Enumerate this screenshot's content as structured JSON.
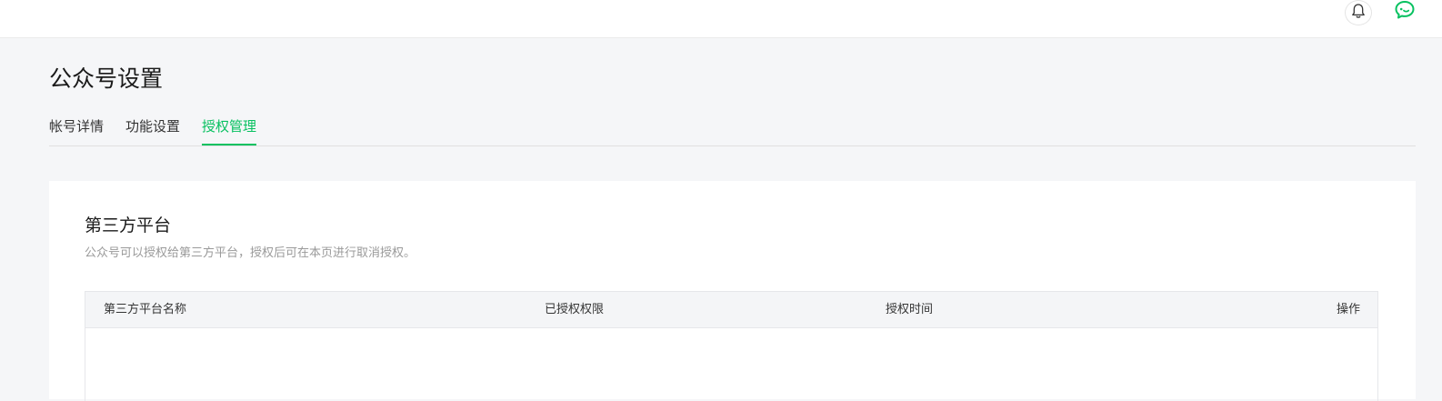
{
  "page": {
    "title": "公众号设置"
  },
  "tabs": [
    {
      "label": "帐号详情",
      "active": false
    },
    {
      "label": "功能设置",
      "active": false
    },
    {
      "label": "授权管理",
      "active": true
    }
  ],
  "section": {
    "title": "第三方平台",
    "description": "公众号可以授权给第三方平台，授权后可在本页进行取消授权。"
  },
  "table": {
    "columns": [
      "第三方平台名称",
      "已授权权限",
      "授权时间",
      "操作"
    ],
    "rows": []
  },
  "header_icons": {
    "notification": "bell-icon",
    "messages": "chat-icon"
  },
  "colors": {
    "accent": "#07c160",
    "background": "#f5f6f8"
  }
}
